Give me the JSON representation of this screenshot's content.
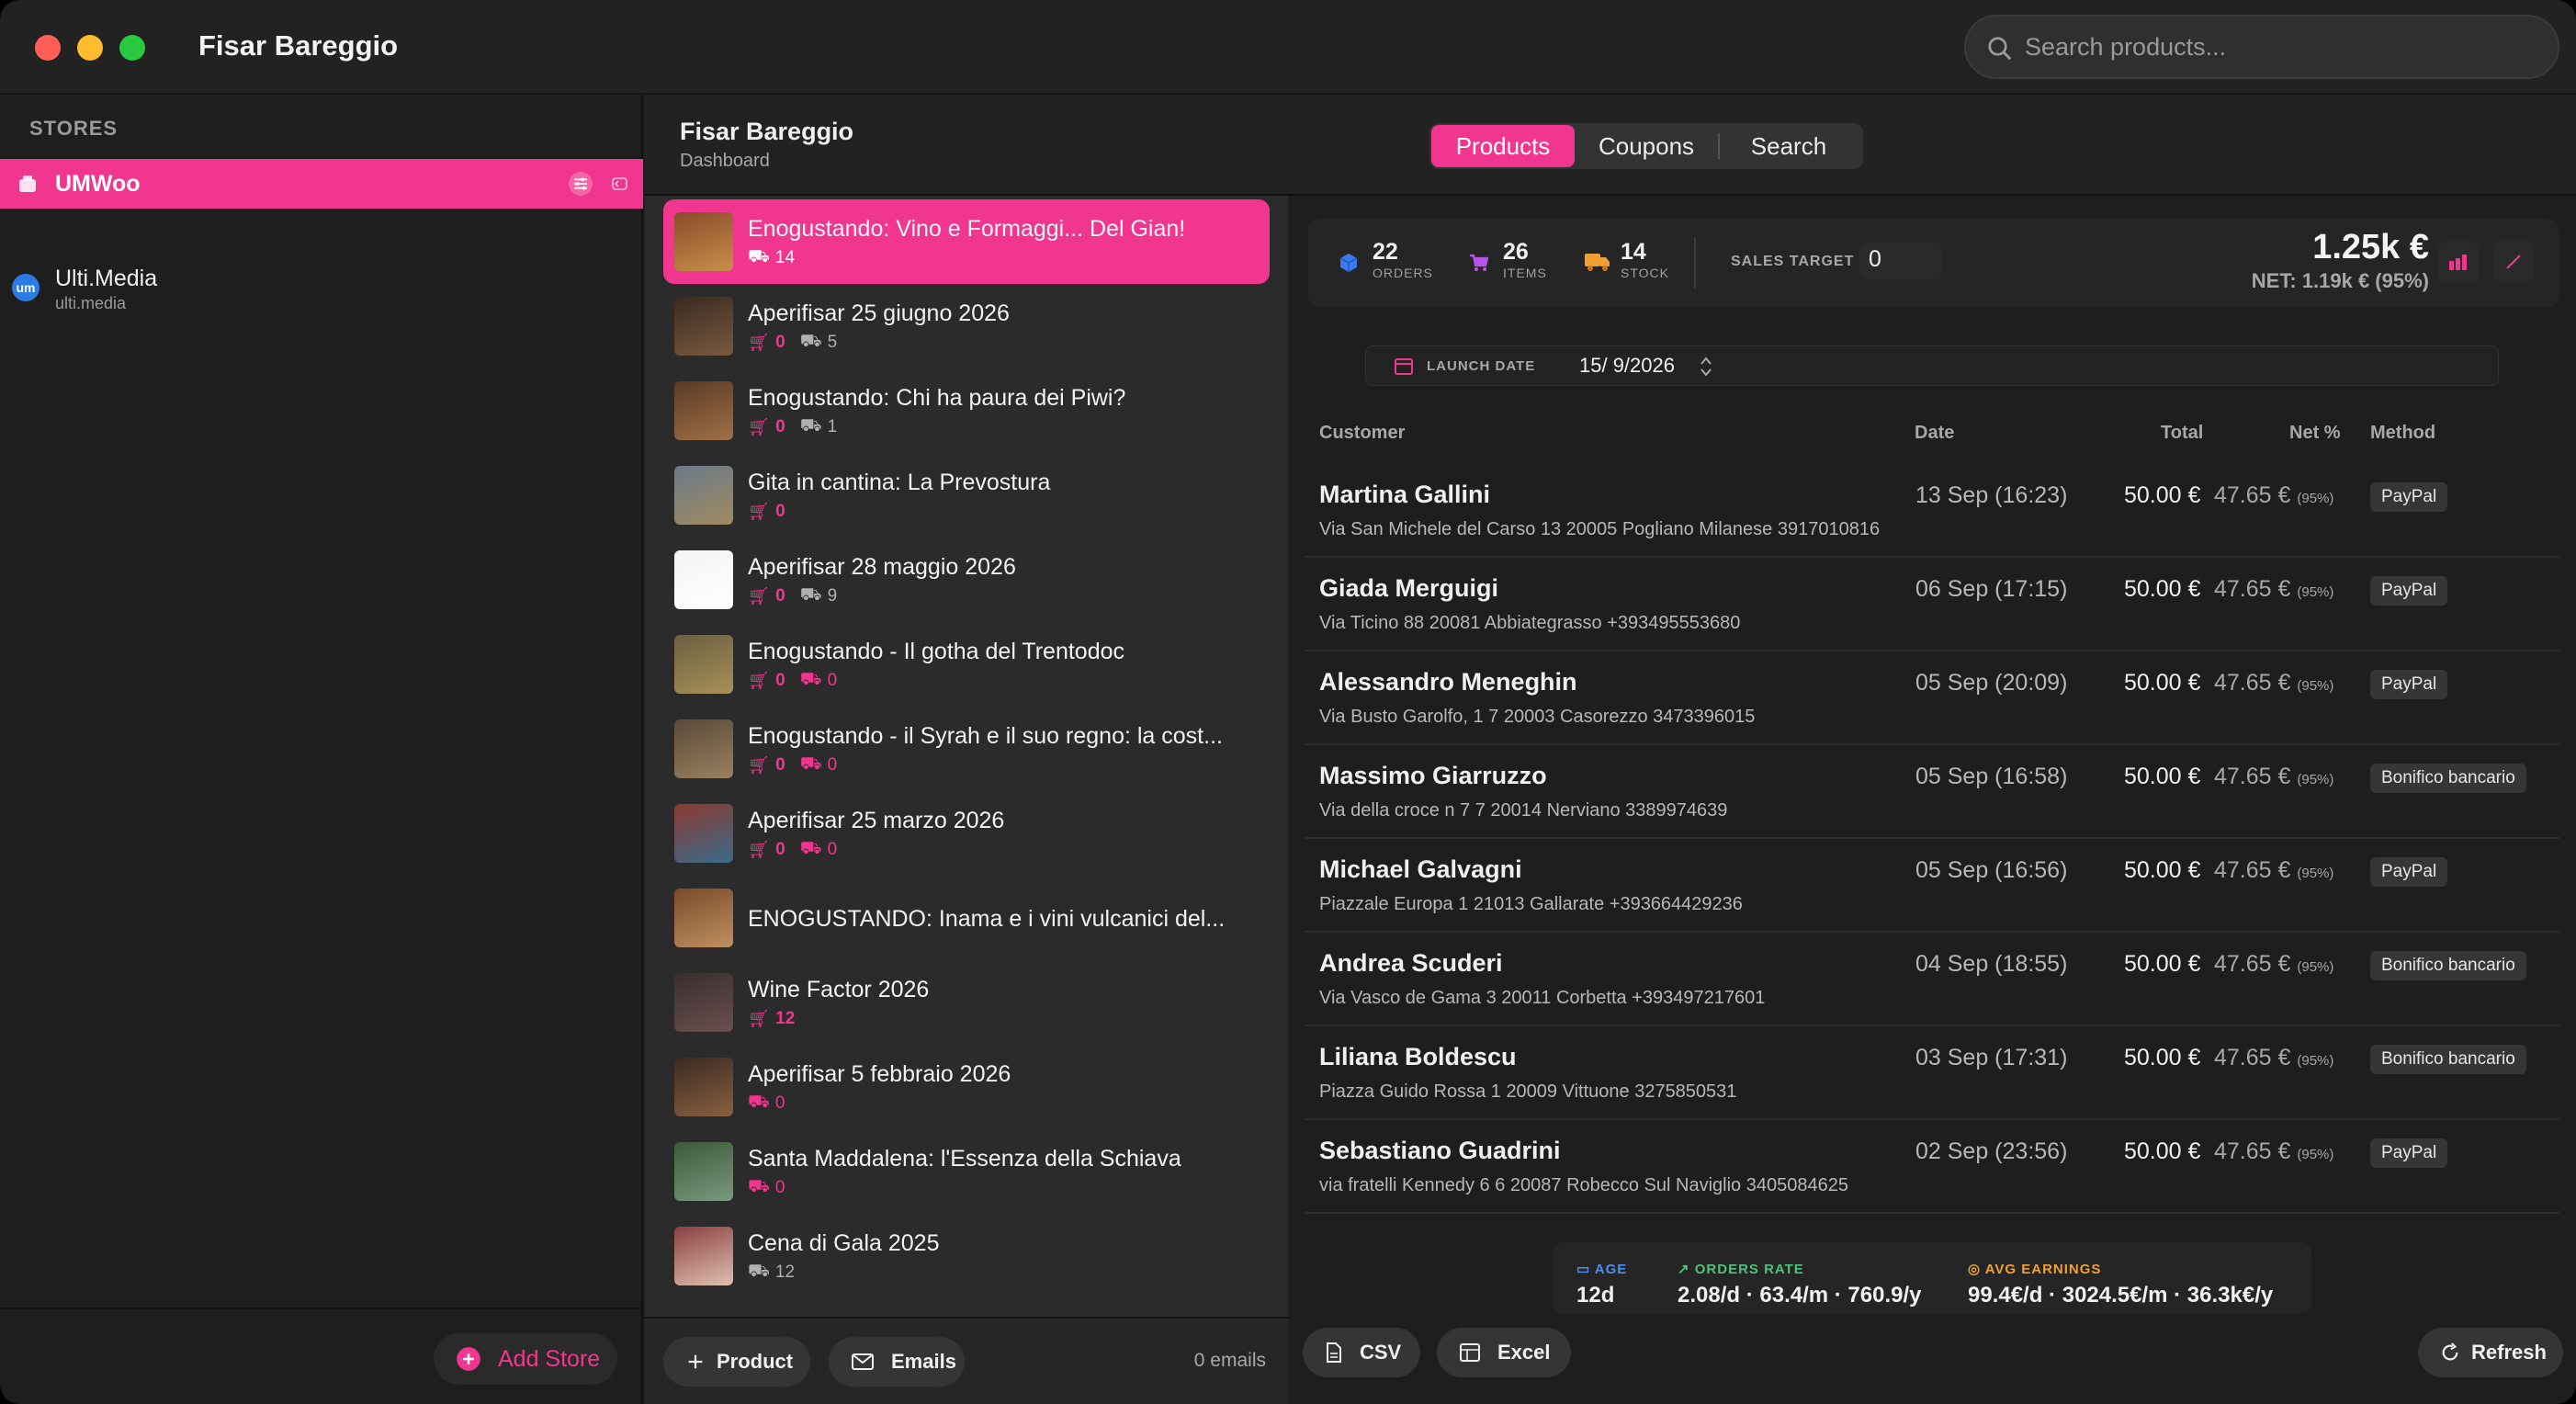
{
  "window": {
    "title": "Fisar Bareggio",
    "search_placeholder": "Search products..."
  },
  "sidebar": {
    "heading": "STORES",
    "stores": [
      {
        "name": "UMWoo",
        "subtitle": "",
        "active": true
      },
      {
        "name": "Ulti.Media",
        "subtitle": "ulti.media",
        "active": false
      }
    ],
    "add_store_label": "Add Store"
  },
  "header": {
    "title": "Fisar Bareggio",
    "subtitle": "Dashboard",
    "tabs": [
      {
        "label": "Products",
        "active": true
      },
      {
        "label": "Coupons",
        "active": false
      },
      {
        "label": "Search",
        "active": false
      }
    ]
  },
  "products": [
    {
      "title": "Enogustando: Vino e Formaggi... Del Gian!",
      "cart": "",
      "truck": "14",
      "truck_red": false
    },
    {
      "title": "Aperifisar 25 giugno 2026",
      "cart": "0",
      "truck": "5",
      "truck_red": false
    },
    {
      "title": "Enogustando: Chi ha paura dei Piwi?",
      "cart": "0",
      "truck": "1",
      "truck_red": false
    },
    {
      "title": "Gita in cantina: La Prevostura",
      "cart": "0",
      "truck": "",
      "truck_red": false
    },
    {
      "title": "Aperifisar 28 maggio 2026",
      "cart": "0",
      "truck": "9",
      "truck_red": false
    },
    {
      "title": "Enogustando - Il gotha del Trentodoc",
      "cart": "0",
      "truck": "0",
      "truck_red": true
    },
    {
      "title": "Enogustando - il Syrah e il suo regno: la cost...",
      "cart": "0",
      "truck": "0",
      "truck_red": true
    },
    {
      "title": "Aperifisar 25 marzo 2026",
      "cart": "0",
      "truck": "0",
      "truck_red": true
    },
    {
      "title": "ENOGUSTANDO: Inama e i vini vulcanici del...",
      "cart": "",
      "truck": "",
      "truck_red": false
    },
    {
      "title": "Wine Factor 2026",
      "cart": "12",
      "truck": "",
      "truck_red": false
    },
    {
      "title": "Aperifisar 5 febbraio 2026",
      "cart": "",
      "truck": "0",
      "truck_red": true
    },
    {
      "title": "Santa Maddalena: l'Essenza della Schiava",
      "cart": "",
      "truck": "0",
      "truck_red": true
    },
    {
      "title": "Cena di Gala 2025",
      "cart": "",
      "truck": "12",
      "truck_red": false
    }
  ],
  "product_footer": {
    "add_label": "Product",
    "emails_label": "Emails",
    "emails_count": "0 emails"
  },
  "stats": {
    "orders": {
      "value": "22",
      "label": "ORDERS"
    },
    "items": {
      "value": "26",
      "label": "ITEMS"
    },
    "stock": {
      "value": "14",
      "label": "STOCK"
    },
    "sales_target_label": "SALES TARGET",
    "sales_target_value": "0",
    "total": "1.25k €",
    "net": "NET: 1.19k € (95%)"
  },
  "launch": {
    "label": "LAUNCH DATE",
    "value": "15/ 9/2026"
  },
  "table": {
    "headers": {
      "customer": "Customer",
      "date": "Date",
      "total": "Total",
      "net": "Net %",
      "method": "Method"
    },
    "rows": [
      {
        "name": "Martina Gallini",
        "addr": "Via San Michele del Carso 13  20005 Pogliano Milanese 3917010816",
        "date": "13 Sep (16:23)",
        "total": "50.00 €",
        "net": "47.65 €",
        "pct": "(95%)",
        "method": "PayPal"
      },
      {
        "name": "Giada Merguigi",
        "addr": "Via Ticino 88  20081 Abbiategrasso +393495553680",
        "date": "06 Sep (17:15)",
        "total": "50.00 €",
        "net": "47.65 €",
        "pct": "(95%)",
        "method": "PayPal"
      },
      {
        "name": "Alessandro Meneghin",
        "addr": "Via Busto Garolfo, 1 7  20003 Casorezzo 3473396015",
        "date": "05 Sep (20:09)",
        "total": "50.00 €",
        "net": "47.65 €",
        "pct": "(95%)",
        "method": "PayPal"
      },
      {
        "name": "Massimo Giarruzzo",
        "addr": "Via della croce n 7 7 20014 Nerviano 3389974639",
        "date": "05 Sep (16:58)",
        "total": "50.00 €",
        "net": "47.65 €",
        "pct": "(95%)",
        "method": "Bonifico bancario"
      },
      {
        "name": "Michael Galvagni",
        "addr": "Piazzale Europa 1  21013 Gallarate +393664429236",
        "date": "05 Sep (16:56)",
        "total": "50.00 €",
        "net": "47.65 €",
        "pct": "(95%)",
        "method": "PayPal"
      },
      {
        "name": "Andrea Scuderi",
        "addr": "Via Vasco de Gama 3  20011 Corbetta +393497217601",
        "date": "04 Sep (18:55)",
        "total": "50.00 €",
        "net": "47.65 €",
        "pct": "(95%)",
        "method": "Bonifico bancario"
      },
      {
        "name": "Liliana Boldescu",
        "addr": "Piazza Guido Rossa 1 20009 Vittuone 3275850531",
        "date": "03 Sep (17:31)",
        "total": "50.00 €",
        "net": "47.65 €",
        "pct": "(95%)",
        "method": "Bonifico bancario"
      },
      {
        "name": "Sebastiano Guadrini",
        "addr": "via fratelli Kennedy 6 6 20087 Robecco Sul Naviglio 3405084625",
        "date": "02 Sep (23:56)",
        "total": "50.00 €",
        "net": "47.65 €",
        "pct": "(95%)",
        "method": "PayPal"
      }
    ]
  },
  "summary": {
    "age": {
      "label": "AGE",
      "value": "12d"
    },
    "orders_rate": {
      "label": "ORDERS RATE",
      "value": "2.08/d · 63.4/m · 760.9/y"
    },
    "avg_earnings": {
      "label": "AVG EARNINGS",
      "value": "99.4€/d · 3024.5€/m · 36.3k€/y"
    }
  },
  "footer": {
    "csv": "CSV",
    "excel": "Excel",
    "refresh": "Refresh"
  },
  "colors": {
    "accent": "#f0368e",
    "bg": "#1e1e1e",
    "panel": "#2b2b2b"
  }
}
